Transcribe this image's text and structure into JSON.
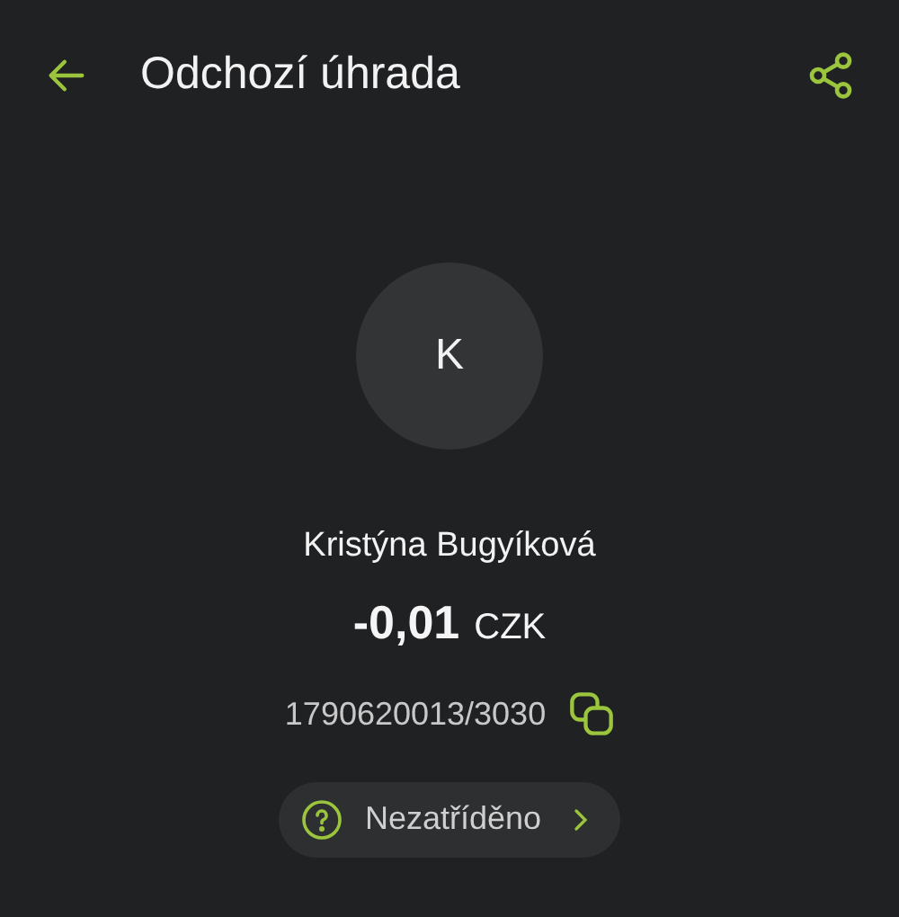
{
  "header": {
    "title": "Odchozí úhrada"
  },
  "counterparty": {
    "initial": "K",
    "name": "Kristýna Bugyíková"
  },
  "amount": {
    "value": "-0,01",
    "currency": "CZK"
  },
  "account": "1790620013/3030",
  "category": {
    "label": "Nezatříděno"
  }
}
